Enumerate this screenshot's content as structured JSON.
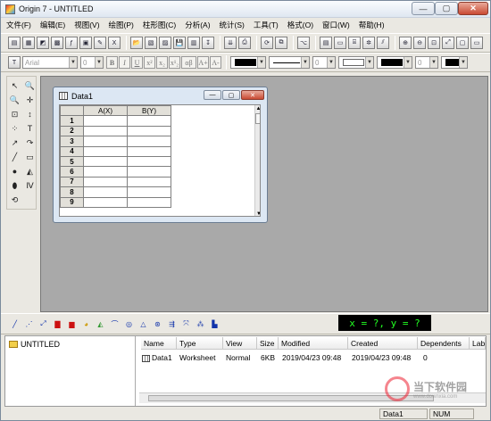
{
  "window": {
    "title": "Origin 7 - UNTITLED",
    "min": "—",
    "max": "▢",
    "close": "✕"
  },
  "menu": [
    "文件(F)",
    "编辑(E)",
    "视图(V)",
    "绘图(P)",
    "柱形图(C)",
    "分析(A)",
    "统计(S)",
    "工具(T)",
    "格式(O)",
    "窗口(W)",
    "帮助(H)"
  ],
  "format_toolbar": {
    "font": "Arial",
    "font_size": "0",
    "bold": "B",
    "italic": "I",
    "underline": "U",
    "superscript": "x²",
    "subscript": "x₂",
    "supsub": "x¹₂",
    "greek": "αβ",
    "larger": "A+",
    "smaller": "A-",
    "line_width": "0",
    "fill_width": "0"
  },
  "left_tools": [
    "↖",
    "🔍",
    "🔍",
    "✛",
    "⊡",
    "↕",
    "⁘",
    "T",
    "↗",
    "↷",
    "╱",
    "▭",
    "●",
    "◭",
    "⬮",
    "Ⅳ",
    "⟲"
  ],
  "worksheet": {
    "title": "Data1",
    "columns": [
      "A(X)",
      "B(Y)"
    ],
    "rows": [
      "1",
      "2",
      "3",
      "4",
      "5",
      "6",
      "7",
      "8",
      "9"
    ]
  },
  "coord_display": "x = ?, y = ?",
  "explorer": {
    "tree_root": "UNTITLED",
    "columns": [
      "Name",
      "Type",
      "View",
      "Size",
      "Modified",
      "Created",
      "Dependents",
      "Lab"
    ],
    "row": {
      "name": "Data1",
      "type": "Worksheet",
      "view": "Normal",
      "size": "6KB",
      "modified": "2019/04/23 09:48",
      "created": "2019/04/23 09:48",
      "dependents": "0"
    }
  },
  "status": {
    "window": "Data1",
    "num": "NUM"
  },
  "watermark": {
    "text": "当下软件园",
    "sub": "www.downxia.com"
  }
}
